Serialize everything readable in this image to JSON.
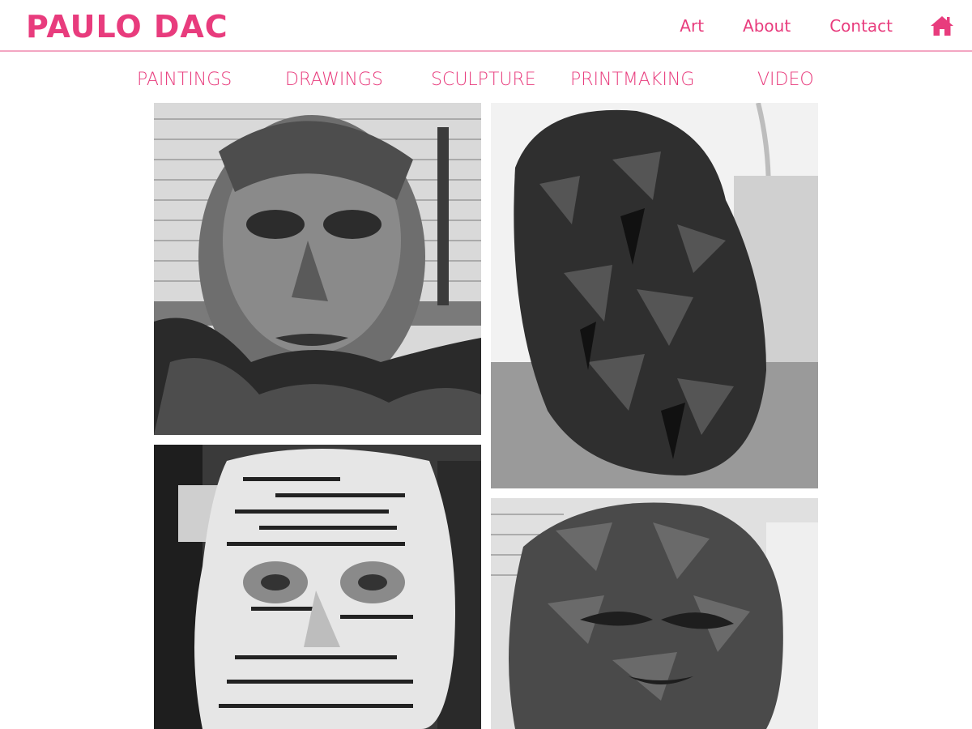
{
  "site": {
    "brand": "PAULO DAC",
    "accent_color": "#e83c7d",
    "divider_color": "#f3a6c2"
  },
  "topnav": {
    "items": [
      {
        "label": "Art"
      },
      {
        "label": "About"
      },
      {
        "label": "Contact"
      }
    ],
    "home_icon": "home-icon"
  },
  "subnav": {
    "items": [
      {
        "label": "PAINTINGS"
      },
      {
        "label": "DRAWINGS"
      },
      {
        "label": "SCULPTURE"
      },
      {
        "label": "PRINTMAKING"
      },
      {
        "label": "VIDEO"
      }
    ]
  },
  "gallery": {
    "images": [
      {
        "subject": "clay-portrait-bust-studio"
      },
      {
        "subject": "rough-clay-head-profile"
      },
      {
        "subject": "newspaper-papier-mache-face"
      },
      {
        "subject": "clay-head-close-up"
      }
    ]
  }
}
